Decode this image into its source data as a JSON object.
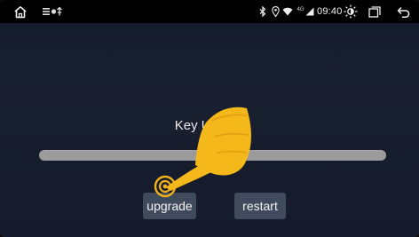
{
  "statusbar": {
    "icons": [
      "home-icon",
      "notification-icons",
      "bluetooth-icon",
      "location-icon",
      "wifi-icon",
      "cellular-signal-icon",
      "brightness-icon",
      "recent-apps-icon",
      "back-icon"
    ],
    "network_label": "4G",
    "time": "09:40"
  },
  "main": {
    "title": "Key Update",
    "progress": 0,
    "buttons": {
      "upgrade": "upgrade",
      "restart": "restart"
    }
  },
  "overlay": {
    "icon": "pointing-hand-tap-icon",
    "color": "#f5b81b"
  }
}
